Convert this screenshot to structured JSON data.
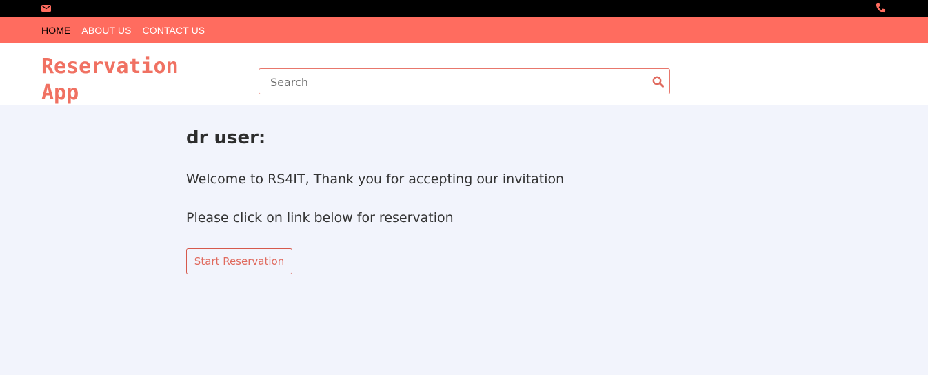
{
  "topbar": {
    "mail_icon": "envelope-icon",
    "phone_icon": "phone-icon",
    "icon_color": "#ff6c5f"
  },
  "nav": {
    "items": [
      {
        "label": "HOME",
        "active": true
      },
      {
        "label": "ABOUT US",
        "active": false
      },
      {
        "label": "CONTACT US",
        "active": false
      }
    ],
    "background": "#ff6c5f"
  },
  "brand": {
    "title": "Reservation App"
  },
  "search": {
    "placeholder": "Search",
    "value": "",
    "icon": "search-icon"
  },
  "content": {
    "greeting": "dr user:",
    "welcome": "Welcome to RS4IT, Thank you for accepting our invitation",
    "instruction": "Please click on link below for reservation",
    "button_label": "Start Reservation"
  }
}
